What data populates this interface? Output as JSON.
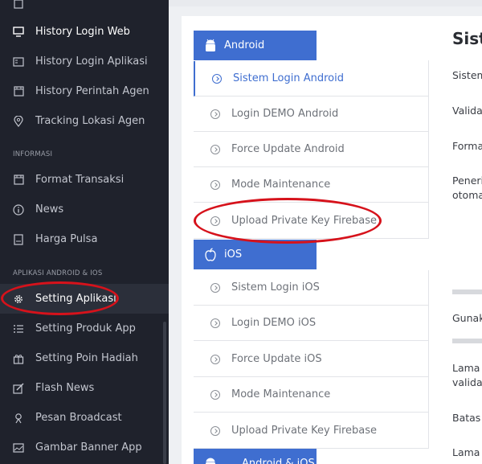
{
  "sidebar": {
    "items": [
      {
        "label": "History Login Web",
        "icon": "monitor-icon"
      },
      {
        "label": "History Login Aplikasi",
        "icon": "card-list-icon"
      },
      {
        "label": "History Perintah Agen",
        "icon": "calendar-icon"
      },
      {
        "label": "Tracking Lokasi Agen",
        "icon": "map-pin-icon"
      },
      {
        "label": "Format Transaksi",
        "icon": "calendar-icon"
      },
      {
        "label": "News",
        "icon": "info-icon"
      },
      {
        "label": "Harga Pulsa",
        "icon": "tag-icon"
      },
      {
        "label": "Setting Aplikasi",
        "icon": "gear-icon"
      },
      {
        "label": "Setting Produk App",
        "icon": "list-icon"
      },
      {
        "label": "Setting Poin Hadiah",
        "icon": "gift-icon"
      },
      {
        "label": "Flash News",
        "icon": "edit-icon"
      },
      {
        "label": "Pesan Broadcast",
        "icon": "broadcast-icon"
      },
      {
        "label": "Gambar Banner App",
        "icon": "image-icon"
      }
    ],
    "sections": {
      "informasi": "INFORMASI",
      "aplikasi": "APLIKASI ANDROID & IOS"
    }
  },
  "groups": {
    "android": {
      "label": "Android",
      "items": [
        "Sistem Login Android",
        "Login DEMO Android",
        "Force Update Android",
        "Mode Maintenance",
        "Upload Private Key Firebase"
      ]
    },
    "ios": {
      "label": "iOS",
      "items": [
        "Sistem Login iOS",
        "Login DEMO iOS",
        "Force Update iOS",
        "Mode Maintenance",
        "Upload Private Key Firebase"
      ]
    },
    "both": {
      "label": "Android & iOS"
    }
  },
  "right_panel": {
    "title": "Siste",
    "lines": [
      "Sistem",
      "Validas",
      "Forma",
      "Peneri",
      "otoma",
      "Gunak",
      "Lama l",
      "validas",
      "Batas l",
      "Lama l"
    ]
  },
  "colors": {
    "accent": "#3f6ed0",
    "sidebar_bg": "#1f222c",
    "annotation": "#d6121b"
  }
}
